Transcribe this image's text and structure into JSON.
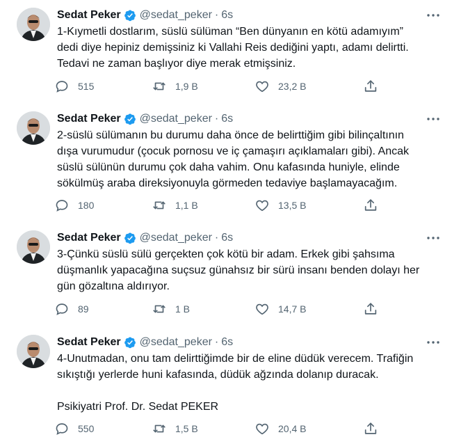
{
  "author": {
    "name": "Sedat Peker",
    "handle": "@sedat_peker",
    "verified": true
  },
  "colors": {
    "verified_badge": "#1d9bf0",
    "secondary_text": "#536471",
    "primary_text": "#0f1419"
  },
  "tweets": [
    {
      "time": "6s",
      "lines": [
        "1-Kıymetli dostlarım, süslü sülüman “Ben dünyanın en kötü adamıyım”",
        "dedi diye hepiniz demişsiniz ki Vallahi Reis dediğini yaptı, adamı delirtti.",
        "Tedavi ne zaman başlıyor diye merak etmişsiniz."
      ],
      "replies": "515",
      "retweets": "1,9 B",
      "likes": "23,2 B"
    },
    {
      "time": "6s",
      "lines": [
        "2-süslü sülümanın bu durumu daha önce de belirttiğim gibi bilinçaltının",
        "dışa vurumudur (çocuk pornosu ve iç çamaşırı açıklamaları gibi). Ancak",
        "süslü sülünün durumu çok daha vahim. Onu kafasında huniyle, elinde",
        "sökülmüş araba direksiyonuyla görmeden tedaviye başlamayacağım."
      ],
      "replies": "180",
      "retweets": "1,1 B",
      "likes": "13,5 B"
    },
    {
      "time": "6s",
      "lines": [
        "3-Çünkü süslü sülü gerçekten çok kötü bir adam. Erkek gibi şahsıma",
        "düşmanlık yapacağına suçsuz günahsız bir sürü insanı benden dolayı her",
        "gün gözaltına aldırıyor."
      ],
      "replies": "89",
      "retweets": "1 B",
      "likes": "14,7 B"
    },
    {
      "time": "6s",
      "lines": [
        "4-Unutmadan, onu tam delirttiğimde bir de eline düdük verecem. Trafiğin",
        "sıkıştığı yerlerde huni kafasında, düdük ağzında dolanıp duracak.",
        "",
        "Psikiyatri Prof. Dr. Sedat PEKER"
      ],
      "replies": "550",
      "retweets": "1,5 B",
      "likes": "20,4 B"
    }
  ]
}
